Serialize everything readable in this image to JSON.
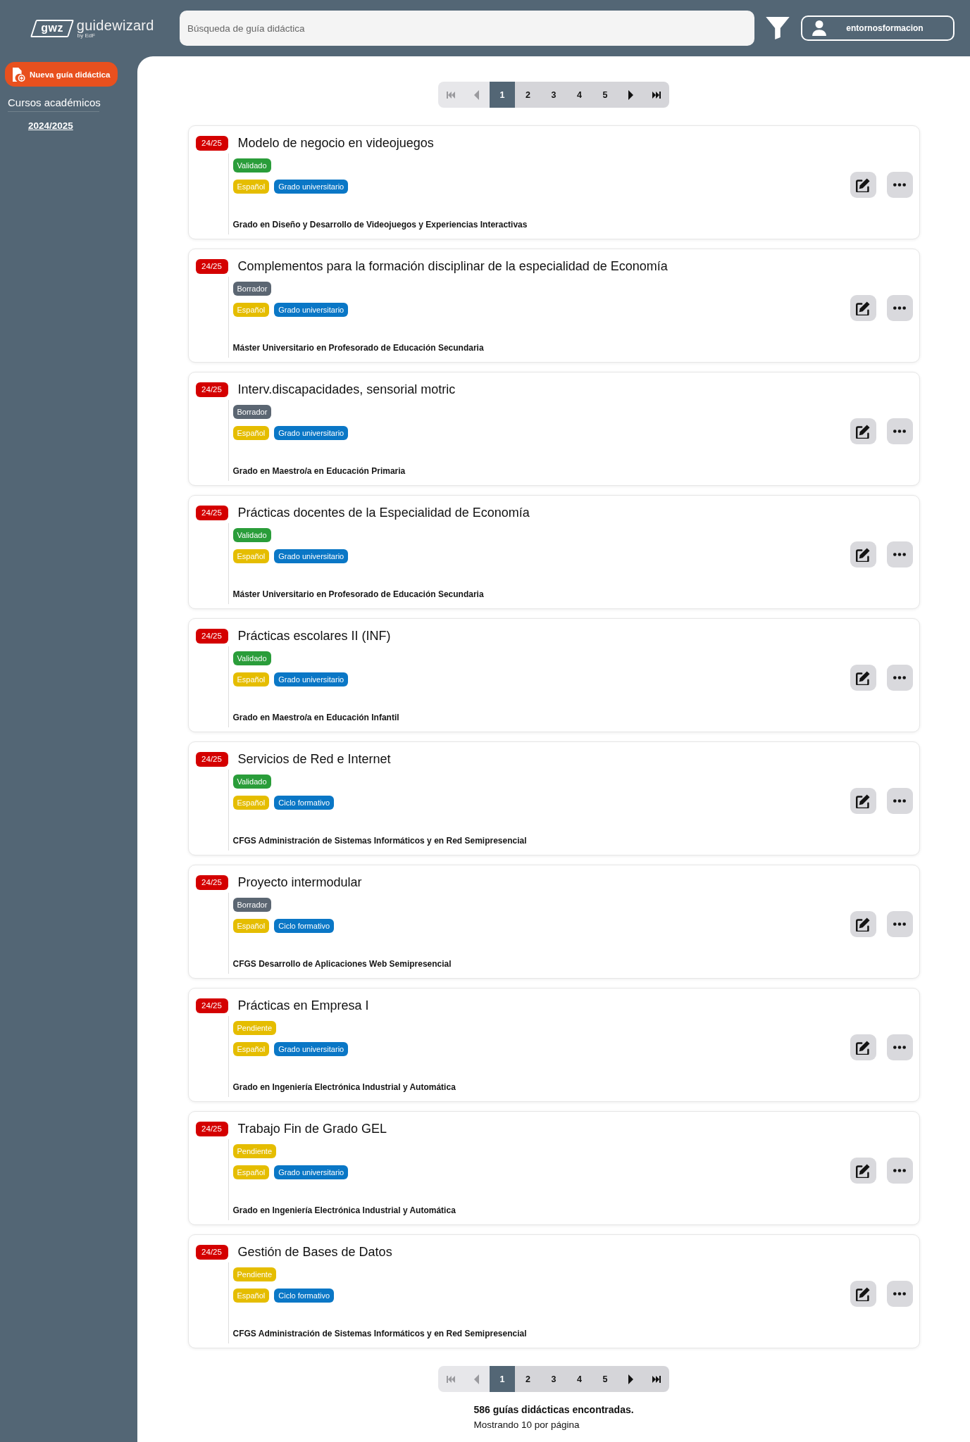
{
  "header": {
    "logo": {
      "mark": "gwz",
      "name": "guidewizard",
      "tagline": "by EdF"
    },
    "search": {
      "placeholder": "Búsqueda de guía didáctica"
    },
    "user": {
      "name": "entornosformacion"
    }
  },
  "sidebar": {
    "new_button": {
      "label": "Nueva guía didáctica"
    },
    "section_title": "Cursos académicos",
    "years": [
      "2024/2025"
    ]
  },
  "pagination_top": [
    {
      "kind": "first",
      "disabled": true,
      "selected": false
    },
    {
      "kind": "prev",
      "disabled": true,
      "selected": false
    },
    {
      "kind": "page",
      "label": "1",
      "disabled": false,
      "selected": true
    },
    {
      "kind": "page",
      "label": "2",
      "disabled": false,
      "selected": false
    },
    {
      "kind": "page",
      "label": "3",
      "disabled": false,
      "selected": false
    },
    {
      "kind": "page",
      "label": "4",
      "disabled": false,
      "selected": false
    },
    {
      "kind": "page",
      "label": "5",
      "disabled": false,
      "selected": false
    },
    {
      "kind": "next",
      "disabled": false,
      "selected": false
    },
    {
      "kind": "last",
      "disabled": false,
      "selected": false
    }
  ],
  "guides": [
    {
      "year": "24/25",
      "title": "Modelo de negocio en videojuegos",
      "status": {
        "label": "Validado",
        "color": "#2a9d3a"
      },
      "tags": [
        {
          "label": "Español",
          "color": "#e5bd00"
        },
        {
          "label": "Grado universitario",
          "color": "#0a77c6"
        }
      ],
      "degree": "Grado en Diseño y Desarrollo de Videojuegos y Experiencias Interactivas"
    },
    {
      "year": "24/25",
      "title": "Complementos para la formación disciplinar de la especialidad de Economía",
      "status": {
        "label": "Borrador",
        "color": "#5b6672"
      },
      "tags": [
        {
          "label": "Español",
          "color": "#e5bd00"
        },
        {
          "label": "Grado universitario",
          "color": "#0a77c6"
        }
      ],
      "degree": "Máster Universitario en Profesorado de Educación Secundaria"
    },
    {
      "year": "24/25",
      "title": "Interv.discapacidades, sensorial motric",
      "status": {
        "label": "Borrador",
        "color": "#5b6672"
      },
      "tags": [
        {
          "label": "Español",
          "color": "#e5bd00"
        },
        {
          "label": "Grado universitario",
          "color": "#0a77c6"
        }
      ],
      "degree": "Grado en Maestro/a en Educación Primaria"
    },
    {
      "year": "24/25",
      "title": "Prácticas docentes de la Especialidad de Economía",
      "status": {
        "label": "Validado",
        "color": "#2a9d3a"
      },
      "tags": [
        {
          "label": "Español",
          "color": "#e5bd00"
        },
        {
          "label": "Grado universitario",
          "color": "#0a77c6"
        }
      ],
      "degree": "Máster Universitario en Profesorado de Educación Secundaria"
    },
    {
      "year": "24/25",
      "title": "Prácticas escolares II (INF)",
      "status": {
        "label": "Validado",
        "color": "#2a9d3a"
      },
      "tags": [
        {
          "label": "Español",
          "color": "#e5bd00"
        },
        {
          "label": "Grado universitario",
          "color": "#0a77c6"
        }
      ],
      "degree": "Grado en Maestro/a en Educación Infantil"
    },
    {
      "year": "24/25",
      "title": "Servicios de Red e Internet",
      "status": {
        "label": "Validado",
        "color": "#2a9d3a"
      },
      "tags": [
        {
          "label": "Español",
          "color": "#e5bd00"
        },
        {
          "label": "Ciclo formativo",
          "color": "#0a77c6"
        }
      ],
      "degree": "CFGS Administración de Sistemas Informáticos y en Red Semipresencial"
    },
    {
      "year": "24/25",
      "title": "Proyecto intermodular",
      "status": {
        "label": "Borrador",
        "color": "#5b6672"
      },
      "tags": [
        {
          "label": "Español",
          "color": "#e5bd00"
        },
        {
          "label": "Ciclo formativo",
          "color": "#0a77c6"
        }
      ],
      "degree": "CFGS Desarrollo de Aplicaciones Web Semipresencial"
    },
    {
      "year": "24/25",
      "title": "Prácticas en Empresa I",
      "status": {
        "label": "Pendiente",
        "color": "#e5bd00"
      },
      "tags": [
        {
          "label": "Español",
          "color": "#e5bd00"
        },
        {
          "label": "Grado universitario",
          "color": "#0a77c6"
        }
      ],
      "degree": "Grado en Ingeniería Electrónica Industrial y Automática"
    },
    {
      "year": "24/25",
      "title": "Trabajo Fin de Grado GEL",
      "status": {
        "label": "Pendiente",
        "color": "#e5bd00"
      },
      "tags": [
        {
          "label": "Español",
          "color": "#e5bd00"
        },
        {
          "label": "Grado universitario",
          "color": "#0a77c6"
        }
      ],
      "degree": "Grado en Ingeniería Electrónica Industrial y Automática"
    },
    {
      "year": "24/25",
      "title": "Gestión de Bases de Datos",
      "status": {
        "label": "Pendiente",
        "color": "#e5bd00"
      },
      "tags": [
        {
          "label": "Español",
          "color": "#e5bd00"
        },
        {
          "label": "Ciclo formativo",
          "color": "#0a77c6"
        }
      ],
      "degree": "CFGS Administración de Sistemas Informáticos y en Red Semipresencial"
    }
  ],
  "pagination_bottom": [
    {
      "kind": "first",
      "disabled": true,
      "selected": false
    },
    {
      "kind": "prev",
      "disabled": true,
      "selected": false
    },
    {
      "kind": "page",
      "label": "1",
      "disabled": false,
      "selected": true
    },
    {
      "kind": "page",
      "label": "2",
      "disabled": false,
      "selected": false
    },
    {
      "kind": "page",
      "label": "3",
      "disabled": false,
      "selected": false
    },
    {
      "kind": "page",
      "label": "4",
      "disabled": false,
      "selected": false
    },
    {
      "kind": "page",
      "label": "5",
      "disabled": false,
      "selected": false
    },
    {
      "kind": "next",
      "disabled": false,
      "selected": false
    },
    {
      "kind": "last",
      "disabled": false,
      "selected": false
    }
  ],
  "results": {
    "total": "586 guías didácticas encontradas.",
    "per_page": "Mostrando 10 por página"
  }
}
